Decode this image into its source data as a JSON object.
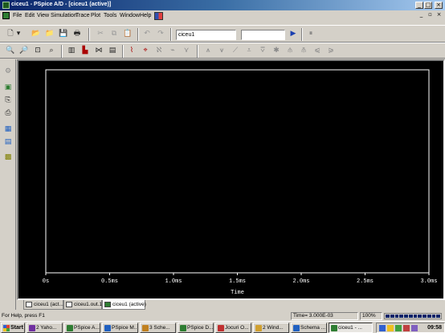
{
  "window": {
    "title": "ciceu1 - PSpice A/D - [ciceu1 (active)]"
  },
  "menu": {
    "items": [
      "File",
      "Edit",
      "View",
      "Simulation",
      "Trace",
      "Plot",
      "Tools",
      "Window",
      "Help"
    ]
  },
  "toolbar": {
    "profile_combo": "ciceu1",
    "run_icon": "play-icon",
    "pause_icon": "pause-icon"
  },
  "plot": {
    "background": "#000000",
    "axis_color": "#ffffff",
    "x_label": "Time"
  },
  "chart_data": {
    "type": "line",
    "xlabel": "Time",
    "ylabel": "",
    "x_ticks": [
      "0s",
      "0.5ms",
      "1.0ms",
      "1.5ms",
      "2.0ms",
      "2.5ms",
      "3.0ms"
    ],
    "xlim": [
      0,
      3.0
    ],
    "x_unit": "ms",
    "series": []
  },
  "tabs": [
    {
      "label": "ciceu1 (act...",
      "active": false
    },
    {
      "label": "ciceu1.out.1",
      "active": false
    },
    {
      "label": "ciceu1 (active)",
      "active": true
    }
  ],
  "status": {
    "help": "For Help, press F1",
    "time": "Time= 3.000E-03",
    "zoom": "100%",
    "progress_segments": 12
  },
  "taskbar": {
    "start": "Start",
    "items": [
      {
        "label": "2 Yaho...",
        "color": "#7030a0"
      },
      {
        "label": "PSpice A...",
        "color": "#2e7d32"
      },
      {
        "label": "PSpice M...",
        "color": "#2060c0"
      },
      {
        "label": "3 Sche...",
        "color": "#c08020"
      },
      {
        "label": "PSpice D...",
        "color": "#2e7d32"
      },
      {
        "label": "Jocuri O...",
        "color": "#c03030"
      },
      {
        "label": "2 Wind...",
        "color": "#d0a030"
      },
      {
        "label": "Schema ...",
        "color": "#2060c0"
      },
      {
        "label": "ciceu1 - ...",
        "color": "#2e7d32",
        "pressed": true
      }
    ],
    "clock": "09:58"
  }
}
